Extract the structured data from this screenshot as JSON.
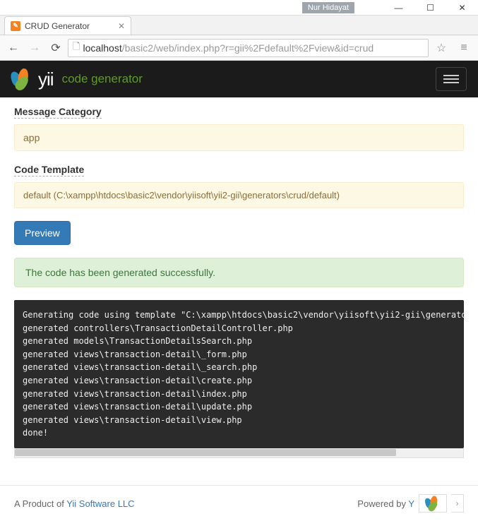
{
  "window": {
    "user_badge": "Nur Hidayat"
  },
  "browser": {
    "tab_title": "CRUD Generator",
    "url_host": "localhost",
    "url_path": "/basic2/web/index.php?r=gii%2Fdefault%2Fview&id=crud"
  },
  "brand": {
    "name": "yii",
    "subtitle": "code generator"
  },
  "form": {
    "message_category_label": "Message Category",
    "message_category_value": "app",
    "code_template_label": "Code Template",
    "code_template_value": "default (C:\\xampp\\htdocs\\basic2\\vendor\\yiisoft\\yii2-gii\\generators\\crud/default)",
    "preview_button": "Preview"
  },
  "alert": {
    "success_text": "The code has been generated successfully."
  },
  "console_output": "Generating code using template \"C:\\xampp\\htdocs\\basic2\\vendor\\yiisoft\\yii2-gii\\generators\\crud/default\"...\ngenerated controllers\\TransactionDetailController.php\ngenerated models\\TransactionDetailsSearch.php\ngenerated views\\transaction-detail\\_form.php\ngenerated views\\transaction-detail\\_search.php\ngenerated views\\transaction-detail\\create.php\ngenerated views\\transaction-detail\\index.php\ngenerated views\\transaction-detail\\update.php\ngenerated views\\transaction-detail\\view.php\ndone!",
  "footer": {
    "product_prefix": "A Product of ",
    "product_link": "Yii Software LLC",
    "powered_prefix": "Powered by ",
    "powered_link": "Y"
  }
}
